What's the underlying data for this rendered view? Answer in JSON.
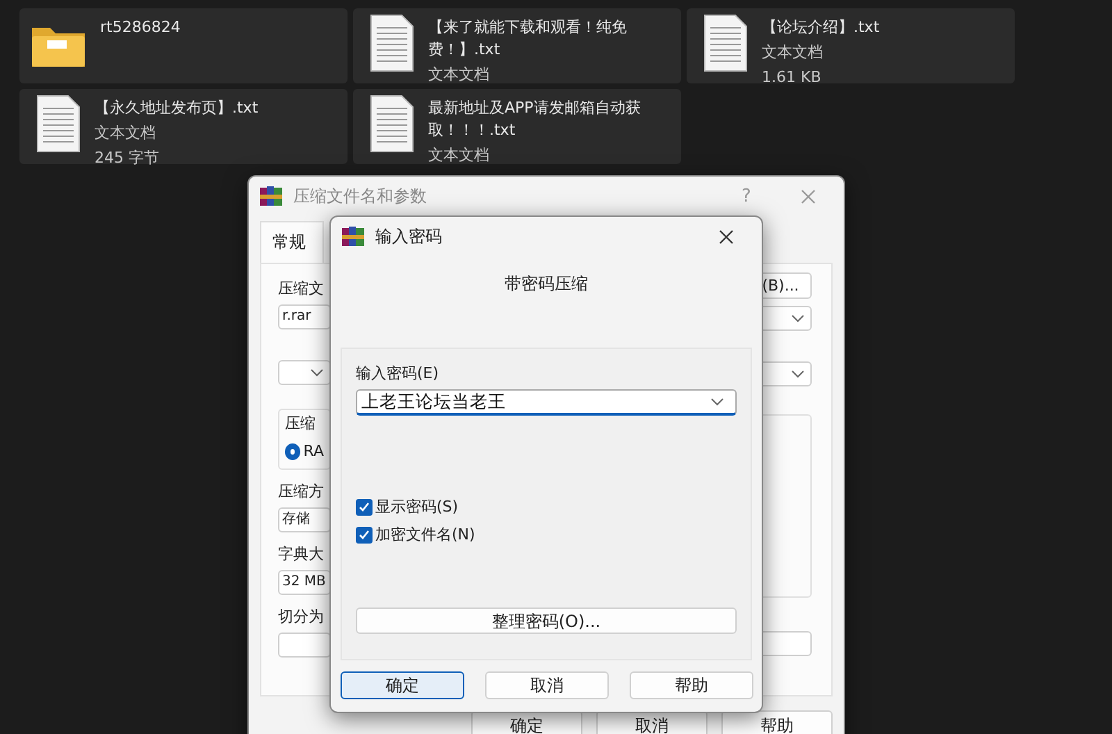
{
  "files": [
    {
      "kind": "folder",
      "name": "rt5286824"
    },
    {
      "kind": "text",
      "name": "【来了就能下载和观看！纯免费！】.txt",
      "type": "文本文档"
    },
    {
      "kind": "text",
      "name": "【论坛介绍】.txt",
      "type": "文本文档",
      "size": "1.61 KB"
    },
    {
      "kind": "text",
      "name": "【永久地址发布页】.txt",
      "type": "文本文档",
      "size": "245 字节"
    },
    {
      "kind": "text",
      "name": "最新地址及APP请发邮箱自动获取！！！.txt",
      "type": "文本文档"
    }
  ],
  "archive_dialog": {
    "title": "压缩文件名和参数",
    "help": "?",
    "tabs": [
      {
        "label": "常规",
        "selected": true
      }
    ],
    "left_column": [
      {
        "kind": "label",
        "text": "压缩文"
      },
      {
        "kind": "field",
        "text": "r.rar"
      },
      {
        "kind": "combo"
      },
      {
        "kind": "group",
        "text": "压缩",
        "radio": {
          "text": "RA",
          "selected": true
        }
      },
      {
        "kind": "label",
        "text": "压缩方"
      },
      {
        "kind": "field",
        "text": "存储"
      },
      {
        "kind": "label",
        "text": "字典大"
      },
      {
        "kind": "field",
        "text": "32 MB"
      },
      {
        "kind": "label",
        "text": "切分为"
      },
      {
        "kind": "field"
      }
    ],
    "right_column": [
      {
        "kind": "button",
        "text": "(B)..."
      },
      {
        "kind": "combo"
      },
      {
        "kind": "combo"
      },
      {
        "kind": "group"
      },
      {
        "kind": "field"
      }
    ],
    "buttons": [
      "确定",
      "取消",
      "帮助"
    ]
  },
  "password_dialog": {
    "title": "输入密码",
    "heading": "带密码压缩",
    "password_label": "输入密码(E)",
    "password_value": "上老王论坛当老王",
    "checkboxes": [
      {
        "label": "显示密码(S)",
        "checked": true
      },
      {
        "label": "加密文件名(N)",
        "checked": true
      }
    ],
    "organize_button": "整理密码(O)...",
    "buttons": [
      {
        "label": "确定",
        "default": true
      },
      {
        "label": "取消",
        "default": false
      },
      {
        "label": "帮助",
        "default": false
      }
    ]
  }
}
